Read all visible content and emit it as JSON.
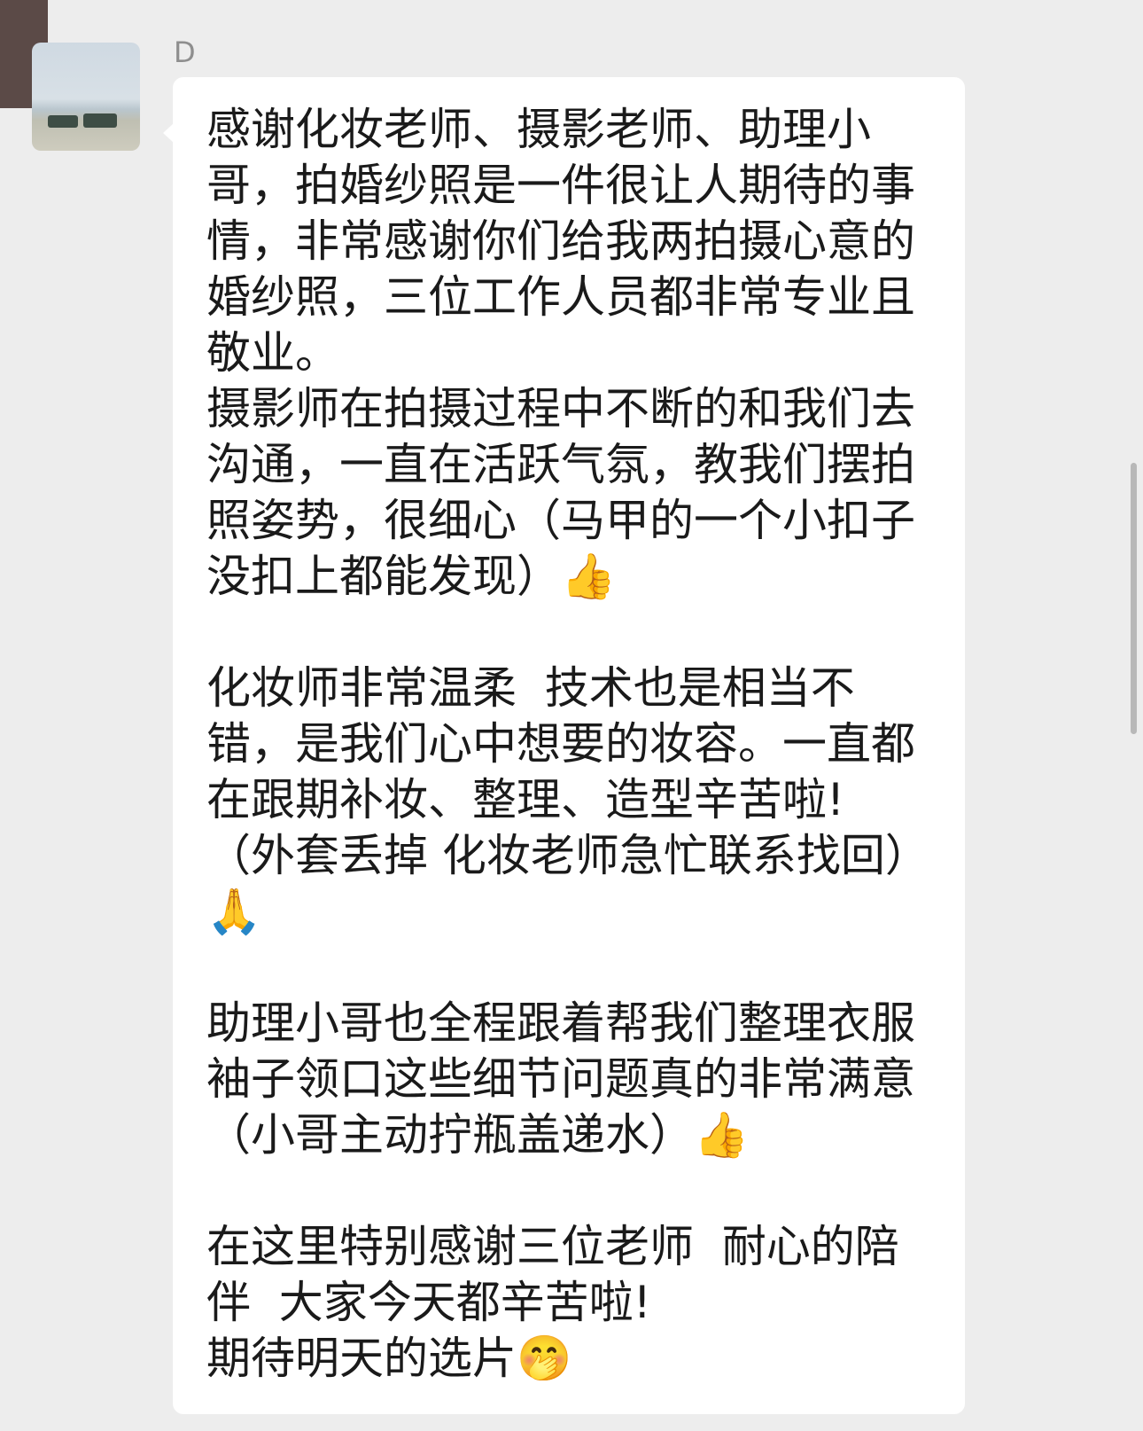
{
  "chat": {
    "sender_name": "D",
    "avatar_icon": "landscape-photo-avatar",
    "message": "感谢化妆老师、摄影老师、助理小哥，拍婚纱照是一件很让人期待的事情，非常感谢你们给我两拍摄心意的婚纱照，三位工作人员都非常专业且敬业。\n摄影师在拍摄过程中不断的和我们去沟通，一直在活跃气氛，教我们摆拍照姿势，很细心（马甲的一个小扣子没扣上都能发现）👍\n\n化妆师非常温柔  技术也是相当不错，是我们心中想要的妆容。一直都在跟期补妆、整理、造型辛苦啦!（外套丢掉 化妆老师急忙联系找回）\n🙏\n\n助理小哥也全程跟着帮我们整理衣服袖子领口这些细节问题真的非常满意（小哥主动拧瓶盖递水）👍\n\n在这里特别感谢三位老师  耐心的陪伴  大家今天都辛苦啦!\n期待明天的选片🤭"
  },
  "colors": {
    "background": "#ededed",
    "bubble": "#ffffff",
    "text": "#1a1a1a",
    "sender_name": "#8e8e8e",
    "scrollbar": "#b8b8b8"
  }
}
